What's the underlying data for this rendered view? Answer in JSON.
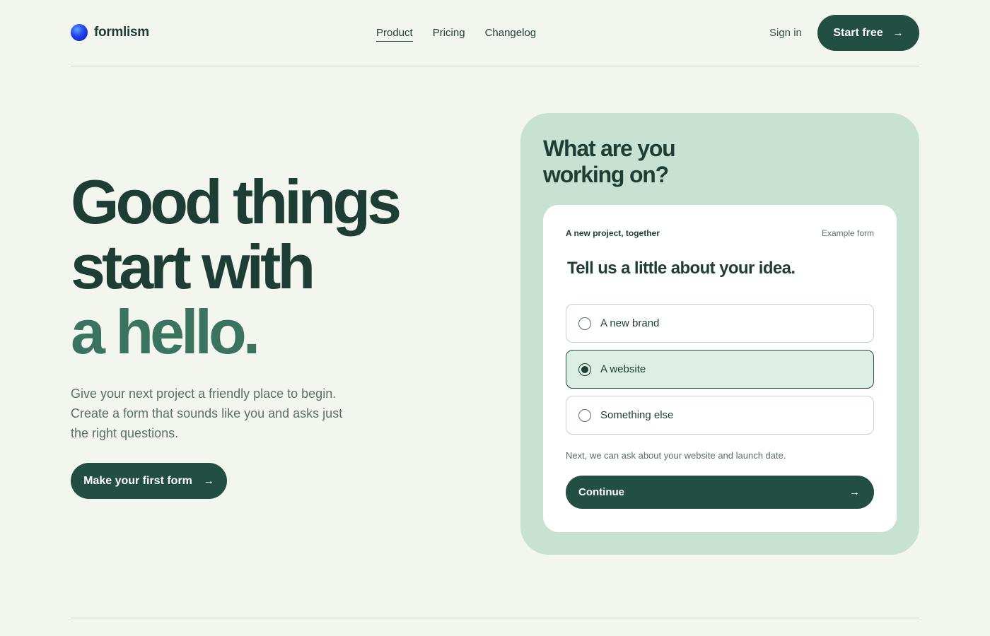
{
  "brand": {
    "name": "formlism",
    "logo_icon": "gradient-orb-icon"
  },
  "nav": {
    "items": [
      {
        "label": "Product",
        "active": true
      },
      {
        "label": "Pricing",
        "active": false
      },
      {
        "label": "Changelog",
        "active": false
      }
    ],
    "sign_in": "Sign in",
    "start_free": "Start free",
    "arrow": "→"
  },
  "hero": {
    "title_lines": [
      "Good things",
      "start with",
      "a hello."
    ],
    "description": "Give your next project a friendly place to begin. Create a form that sounds like you and asks just the right questions.",
    "cta": "Make your first form"
  },
  "card": {
    "title": "What are you working on?",
    "form": {
      "label": "A new project, together",
      "example": "Example form",
      "question": "Tell us a little about your idea.",
      "options": [
        {
          "label": "A new brand",
          "selected": false
        },
        {
          "label": "A website",
          "selected": true
        },
        {
          "label": "Something else",
          "selected": false
        }
      ],
      "hint": "Next, we can ask about your website and launch date.",
      "continue": "Continue"
    }
  },
  "colors": {
    "background": "#f3f6ee",
    "primary": "#234e42",
    "accent": "#3a7360",
    "card": "#c7e1d3",
    "selected_option": "#ddeee4"
  }
}
